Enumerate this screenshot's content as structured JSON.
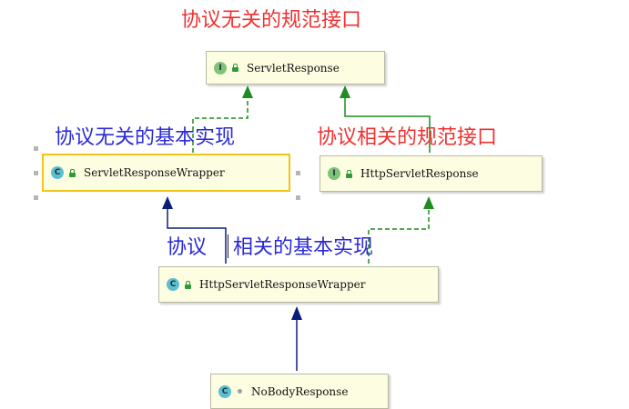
{
  "annotations": {
    "top_label": "协议无关的规范接口",
    "left_label": "协议无关的基本实现",
    "right_label": "协议相关的规范接口",
    "middle_label_part1": "协议",
    "middle_label_part2": "相关的基本实现"
  },
  "annotation_colors": {
    "red": "#f03030",
    "blue": "#2a2ad8"
  },
  "nodes": {
    "servlet_response": {
      "label": "ServletResponse",
      "kind": "interface",
      "badge": "I",
      "icon": "public-lock-icon"
    },
    "servlet_response_wrapper": {
      "label": "ServletResponseWrapper",
      "kind": "class",
      "badge": "C",
      "icon": "public-lock-icon",
      "selected": true
    },
    "http_servlet_response": {
      "label": "HttpServletResponse",
      "kind": "interface",
      "badge": "I",
      "icon": "public-lock-icon"
    },
    "http_servlet_response_wrapper": {
      "label": "HttpServletResponseWrapper",
      "kind": "class",
      "badge": "C",
      "icon": "public-lock-icon"
    },
    "no_body_response": {
      "label": "NoBodyResponse",
      "kind": "class",
      "badge": "C",
      "icon": "package-private-icon"
    }
  },
  "edge_colors": {
    "extends": "#0b1f7a",
    "implements": "#1e8c1e"
  },
  "relations": [
    {
      "from": "servlet_response_wrapper",
      "to": "servlet_response",
      "type": "implements"
    },
    {
      "from": "http_servlet_response",
      "to": "servlet_response",
      "type": "extends-interface"
    },
    {
      "from": "http_servlet_response_wrapper",
      "to": "servlet_response_wrapper",
      "type": "extends"
    },
    {
      "from": "http_servlet_response_wrapper",
      "to": "http_servlet_response",
      "type": "implements"
    },
    {
      "from": "no_body_response",
      "to": "http_servlet_response_wrapper",
      "type": "extends"
    }
  ]
}
